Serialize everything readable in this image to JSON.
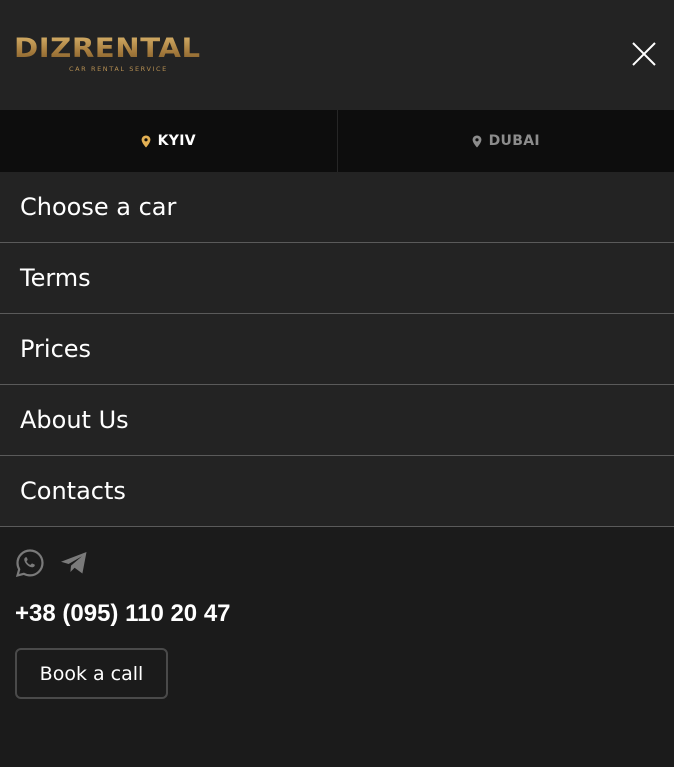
{
  "header": {
    "logo_text": "DIZRENTAL",
    "logo_tagline": "CAR RENTAL SERVICE",
    "close_icon": "close-icon"
  },
  "city_tabs": [
    {
      "label": "KYIV",
      "active": true,
      "icon": "location-pin-icon"
    },
    {
      "label": "DUBAI",
      "active": false,
      "icon": "location-pin-icon"
    }
  ],
  "nav": {
    "items": [
      {
        "label": "Choose a car"
      },
      {
        "label": "Terms"
      },
      {
        "label": "Prices"
      },
      {
        "label": "About Us"
      },
      {
        "label": "Contacts"
      }
    ]
  },
  "contacts": {
    "social": [
      {
        "icon": "whatsapp-icon"
      },
      {
        "icon": "telegram-icon"
      }
    ],
    "phone": "+38 (095) 110 20 47",
    "book_button": "Book a call"
  },
  "colors": {
    "accent_gold": "#c49a55",
    "background": "#1b1b1b",
    "panel": "#232323",
    "tab_bar": "#0d0d0d",
    "inactive_text": "#8c8c8c"
  }
}
